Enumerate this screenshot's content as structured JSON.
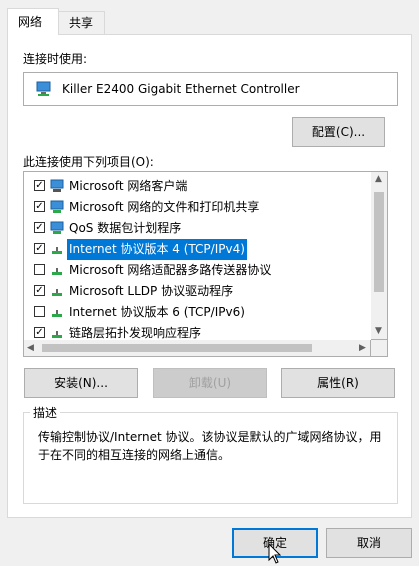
{
  "tabs": [
    {
      "label": "网络"
    },
    {
      "label": "共享"
    }
  ],
  "connect_using": {
    "label": "连接时使用:",
    "adapter_name": "Killer E2400 Gigabit Ethernet Controller",
    "configure_button": "配置(C)..."
  },
  "items_section": {
    "label": "此连接使用下列项目(O):",
    "items": [
      {
        "label": "Microsoft 网络客户端",
        "checked": true,
        "icon": "network-client-icon"
      },
      {
        "label": "Microsoft 网络的文件和打印机共享",
        "checked": true,
        "icon": "file-printer-sharing-icon"
      },
      {
        "label": "QoS 数据包计划程序",
        "checked": true,
        "icon": "qos-icon"
      },
      {
        "label": "Internet 协议版本 4 (TCP/IPv4)",
        "checked": true,
        "icon": "protocol-icon",
        "selected": true
      },
      {
        "label": "Microsoft 网络适配器多路传送器协议",
        "checked": false,
        "icon": "protocol-icon"
      },
      {
        "label": "Microsoft LLDP 协议驱动程序",
        "checked": true,
        "icon": "protocol-icon"
      },
      {
        "label": "Internet 协议版本 6 (TCP/IPv6)",
        "checked": false,
        "icon": "protocol-icon"
      },
      {
        "label": "链路层拓扑发现响应程序",
        "checked": true,
        "icon": "protocol-icon"
      }
    ]
  },
  "actions": {
    "install": "安装(N)...",
    "uninstall": "卸载(U)",
    "properties": "属性(R)"
  },
  "description": {
    "title": "描述",
    "text_line1": "传输控制协议/Internet 协议。该协议是默认的广域网络协议，用",
    "text_line2": "于在不同的相互连接的网络上通信。"
  },
  "footer": {
    "ok": "确定",
    "cancel": "取消"
  },
  "colors": {
    "selection": "#0078d7",
    "focus_border": "#0078d7"
  }
}
